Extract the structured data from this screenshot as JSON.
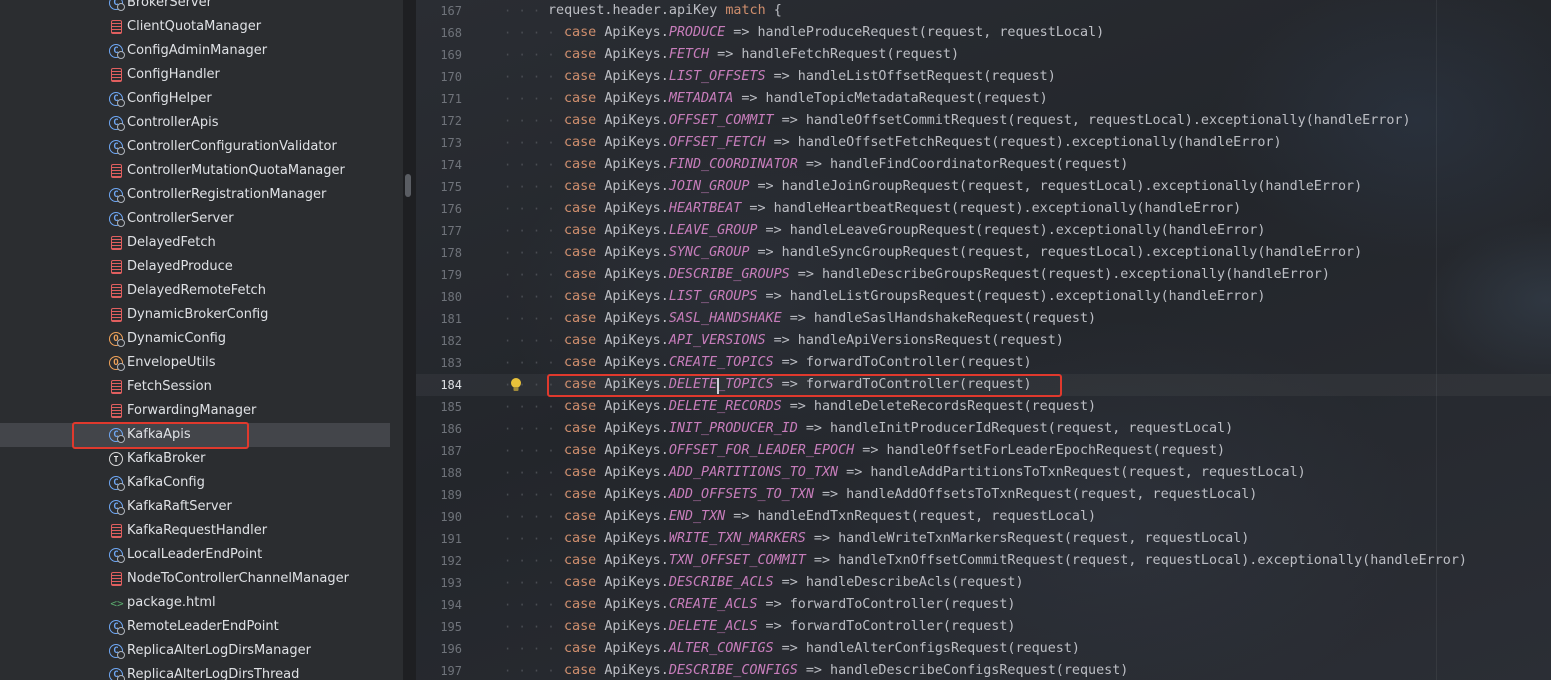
{
  "project_tree": {
    "items": [
      {
        "label": "BrokerServer",
        "icon": "class-icon"
      },
      {
        "label": "ClientQuotaManager",
        "icon": "file-icon"
      },
      {
        "label": "ConfigAdminManager",
        "icon": "class-icon"
      },
      {
        "label": "ConfigHandler",
        "icon": "file-icon"
      },
      {
        "label": "ConfigHelper",
        "icon": "class-icon"
      },
      {
        "label": "ControllerApis",
        "icon": "class-icon"
      },
      {
        "label": "ControllerConfigurationValidator",
        "icon": "class-icon"
      },
      {
        "label": "ControllerMutationQuotaManager",
        "icon": "file-icon"
      },
      {
        "label": "ControllerRegistrationManager",
        "icon": "class-icon"
      },
      {
        "label": "ControllerServer",
        "icon": "class-icon"
      },
      {
        "label": "DelayedFetch",
        "icon": "file-icon"
      },
      {
        "label": "DelayedProduce",
        "icon": "file-icon"
      },
      {
        "label": "DelayedRemoteFetch",
        "icon": "file-icon"
      },
      {
        "label": "DynamicBrokerConfig",
        "icon": "file-icon"
      },
      {
        "label": "DynamicConfig",
        "icon": "object-icon"
      },
      {
        "label": "EnvelopeUtils",
        "icon": "object-icon"
      },
      {
        "label": "FetchSession",
        "icon": "file-icon"
      },
      {
        "label": "ForwardingManager",
        "icon": "file-icon"
      },
      {
        "label": "KafkaApis",
        "icon": "class-icon",
        "selected": true
      },
      {
        "label": "KafkaBroker",
        "icon": "trait-icon"
      },
      {
        "label": "KafkaConfig",
        "icon": "class-icon"
      },
      {
        "label": "KafkaRaftServer",
        "icon": "class-icon"
      },
      {
        "label": "KafkaRequestHandler",
        "icon": "file-icon"
      },
      {
        "label": "LocalLeaderEndPoint",
        "icon": "class-icon"
      },
      {
        "label": "NodeToControllerChannelManager",
        "icon": "file-icon"
      },
      {
        "label": "package.html",
        "icon": "html-file-icon"
      },
      {
        "label": "RemoteLeaderEndPoint",
        "icon": "class-icon"
      },
      {
        "label": "ReplicaAlterLogDirsManager",
        "icon": "class-icon"
      },
      {
        "label": "ReplicaAlterLogDirsThread",
        "icon": "class-icon"
      }
    ]
  },
  "editor": {
    "current_line": "184",
    "header_line": {
      "num": "167",
      "code": "request.header.apiKey ",
      "kw": "match",
      "end": " {"
    },
    "cases": [
      {
        "num": "168",
        "key": "PRODUCE",
        "call": " => handleProduceRequest(request, requestLocal)"
      },
      {
        "num": "169",
        "key": "FETCH",
        "call": " => handleFetchRequest(request)"
      },
      {
        "num": "170",
        "key": "LIST_OFFSETS",
        "call": " => handleListOffsetRequest(request)"
      },
      {
        "num": "171",
        "key": "METADATA",
        "call": " => handleTopicMetadataRequest(request)"
      },
      {
        "num": "172",
        "key": "OFFSET_COMMIT",
        "call": " => handleOffsetCommitRequest(request, requestLocal).exceptionally(handleError)"
      },
      {
        "num": "173",
        "key": "OFFSET_FETCH",
        "call": " => handleOffsetFetchRequest(request).exceptionally(handleError)"
      },
      {
        "num": "174",
        "key": "FIND_COORDINATOR",
        "call": " => handleFindCoordinatorRequest(request)"
      },
      {
        "num": "175",
        "key": "JOIN_GROUP",
        "call": " => handleJoinGroupRequest(request, requestLocal).exceptionally(handleError)"
      },
      {
        "num": "176",
        "key": "HEARTBEAT",
        "call": " => handleHeartbeatRequest(request).exceptionally(handleError)"
      },
      {
        "num": "177",
        "key": "LEAVE_GROUP",
        "call": " => handleLeaveGroupRequest(request).exceptionally(handleError)"
      },
      {
        "num": "178",
        "key": "SYNC_GROUP",
        "call": " => handleSyncGroupRequest(request, requestLocal).exceptionally(handleError)"
      },
      {
        "num": "179",
        "key": "DESCRIBE_GROUPS",
        "call": " => handleDescribeGroupsRequest(request).exceptionally(handleError)"
      },
      {
        "num": "180",
        "key": "LIST_GROUPS",
        "call": " => handleListGroupsRequest(request).exceptionally(handleError)"
      },
      {
        "num": "181",
        "key": "SASL_HANDSHAKE",
        "call": " => handleSaslHandshakeRequest(request)"
      },
      {
        "num": "182",
        "key": "API_VERSIONS",
        "call": " => handleApiVersionsRequest(request)"
      },
      {
        "num": "183",
        "key": "CREATE_TOPICS",
        "call": " => forwardToController(request)"
      },
      {
        "num": "184",
        "key": "DELETE_TOPICS",
        "call": " => forwardToController(request)",
        "current": true
      },
      {
        "num": "185",
        "key": "DELETE_RECORDS",
        "call": " => handleDeleteRecordsRequest(request)"
      },
      {
        "num": "186",
        "key": "INIT_PRODUCER_ID",
        "call": " => handleInitProducerIdRequest(request, requestLocal)"
      },
      {
        "num": "187",
        "key": "OFFSET_FOR_LEADER_EPOCH",
        "call": " => handleOffsetForLeaderEpochRequest(request)"
      },
      {
        "num": "188",
        "key": "ADD_PARTITIONS_TO_TXN",
        "call": " => handleAddPartitionsToTxnRequest(request, requestLocal)"
      },
      {
        "num": "189",
        "key": "ADD_OFFSETS_TO_TXN",
        "call": " => handleAddOffsetsToTxnRequest(request, requestLocal)"
      },
      {
        "num": "190",
        "key": "END_TXN",
        "call": " => handleEndTxnRequest(request, requestLocal)"
      },
      {
        "num": "191",
        "key": "WRITE_TXN_MARKERS",
        "call": " => handleWriteTxnMarkersRequest(request, requestLocal)"
      },
      {
        "num": "192",
        "key": "TXN_OFFSET_COMMIT",
        "call": " => handleTxnOffsetCommitRequest(request, requestLocal).exceptionally(handleError)"
      },
      {
        "num": "193",
        "key": "DESCRIBE_ACLS",
        "call": " => handleDescribeAcls(request)"
      },
      {
        "num": "194",
        "key": "CREATE_ACLS",
        "call": " => forwardToController(request)"
      },
      {
        "num": "195",
        "key": "DELETE_ACLS",
        "call": " => forwardToController(request)"
      },
      {
        "num": "196",
        "key": "ALTER_CONFIGS",
        "call": " => handleAlterConfigsRequest(request)"
      },
      {
        "num": "197",
        "key": "DESCRIBE_CONFIGS",
        "call": " => handleDescribeConfigsRequest(request)"
      }
    ],
    "case_keyword": "case",
    "enum_prefix": "ApiKeys."
  },
  "colors": {
    "keyword": "#cf8e6d",
    "constant": "#c77dbb",
    "highlight_box": "#e0392d"
  }
}
